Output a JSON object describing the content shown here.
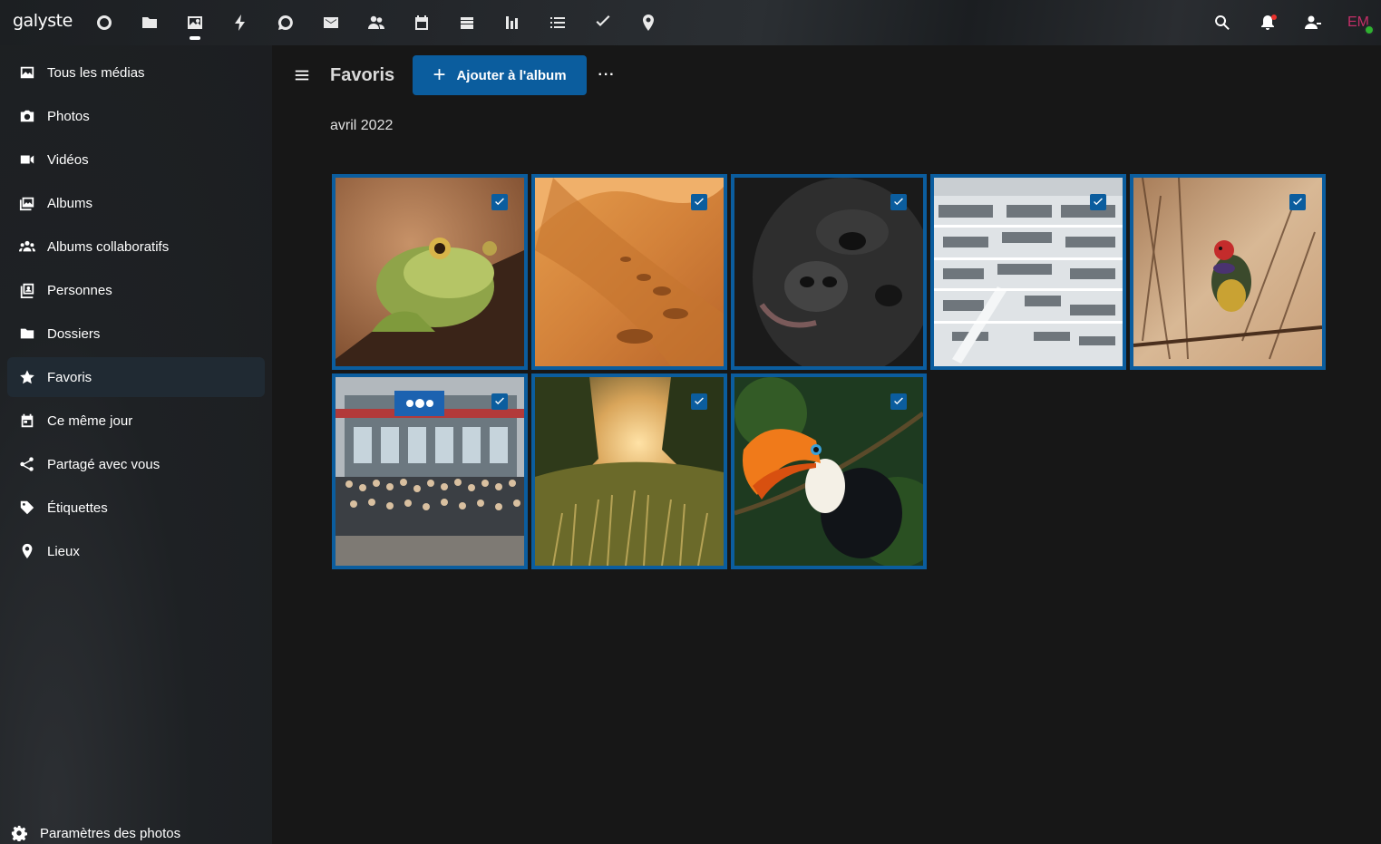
{
  "app": {
    "logo": "galyste"
  },
  "topbar": {
    "apps": [
      {
        "name": "dashboard",
        "icon": "circle-icon"
      },
      {
        "name": "files",
        "icon": "folder-icon"
      },
      {
        "name": "photos",
        "icon": "image-icon",
        "active": true
      },
      {
        "name": "activity",
        "icon": "bolt-icon"
      },
      {
        "name": "talk",
        "icon": "chat-icon"
      },
      {
        "name": "mail",
        "icon": "mail-icon"
      },
      {
        "name": "contacts",
        "icon": "contacts-icon"
      },
      {
        "name": "calendar",
        "icon": "calendar-icon"
      },
      {
        "name": "deck",
        "icon": "deck-icon"
      },
      {
        "name": "analytics",
        "icon": "chart-icon"
      },
      {
        "name": "tasks-list",
        "icon": "list-icon"
      },
      {
        "name": "tasks",
        "icon": "check-icon"
      },
      {
        "name": "maps",
        "icon": "map-pin-icon"
      }
    ],
    "right": {
      "search_icon": "search-icon",
      "notifications_icon": "bell-icon",
      "contacts_icon": "contacts-menu-icon",
      "avatar_initials": "EM"
    }
  },
  "sidebar": {
    "items": [
      {
        "label": "Tous les médias",
        "icon": "image-icon"
      },
      {
        "label": "Photos",
        "icon": "camera-icon"
      },
      {
        "label": "Vidéos",
        "icon": "video-icon"
      },
      {
        "label": "Albums",
        "icon": "album-icon"
      },
      {
        "label": "Albums collaboratifs",
        "icon": "group-icon"
      },
      {
        "label": "Personnes",
        "icon": "person-icon"
      },
      {
        "label": "Dossiers",
        "icon": "folder-icon"
      },
      {
        "label": "Favoris",
        "icon": "star-icon",
        "active": true
      },
      {
        "label": "Ce même jour",
        "icon": "calendar-icon"
      },
      {
        "label": "Partagé avec vous",
        "icon": "share-icon"
      },
      {
        "label": "Étiquettes",
        "icon": "tag-icon"
      },
      {
        "label": "Lieux",
        "icon": "map-pin-icon"
      }
    ],
    "settings_label": "Paramètres des photos"
  },
  "main": {
    "title": "Favoris",
    "add_button_label": "Ajouter à l'album",
    "more_label": "···",
    "section_date": "avril 2022",
    "photos": [
      {
        "subject": "frog",
        "selected": true
      },
      {
        "subject": "desert-dunes",
        "selected": true
      },
      {
        "subject": "gorilla",
        "selected": true
      },
      {
        "subject": "library",
        "selected": true
      },
      {
        "subject": "finch-bird",
        "selected": true
      },
      {
        "subject": "group-photo",
        "selected": true
      },
      {
        "subject": "sunset-field",
        "selected": true
      },
      {
        "subject": "toucan",
        "selected": true
      }
    ]
  },
  "colors": {
    "accent": "#0b5d9e",
    "background": "#171717",
    "sidebar": "#1e2124",
    "avatar_text": "#c22f67",
    "status_online": "#2fb130"
  }
}
